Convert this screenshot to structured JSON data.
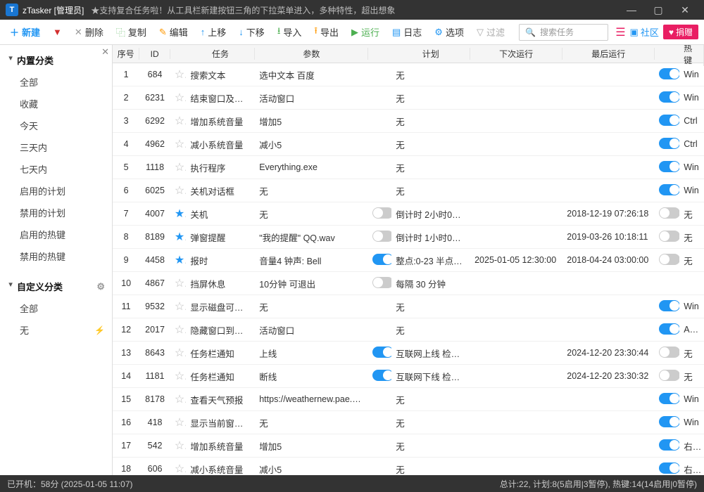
{
  "title": "zTasker [管理员]",
  "subtitle": "★支持复合任务啦！从工具栏新建按钮三角的下拉菜单进入，多种特性，超出想象",
  "toolbar": {
    "new": "新建",
    "delete": "删除",
    "copy": "复制",
    "edit": "编辑",
    "up": "上移",
    "down": "下移",
    "import": "导入",
    "export": "导出",
    "run": "运行",
    "log": "日志",
    "options": "选项",
    "filter": "过滤",
    "search_placeholder": "搜索任务",
    "community": "社区",
    "donate": "捐赠"
  },
  "sidebar": {
    "builtin": {
      "title": "内置分类",
      "items": [
        "全部",
        "收藏",
        "今天",
        "三天内",
        "七天内",
        "启用的计划",
        "禁用的计划",
        "启用的热键",
        "禁用的热键"
      ]
    },
    "custom": {
      "title": "自定义分类",
      "items": [
        "全部",
        "无"
      ]
    }
  },
  "columns": {
    "seq": "序号",
    "id": "ID",
    "name": "任务",
    "param": "参数",
    "plan": "计划",
    "next": "下次运行",
    "last": "最后运行",
    "hot": "热键"
  },
  "rows": [
    {
      "seq": 1,
      "id": 684,
      "fav": false,
      "name": "搜索文本",
      "param": "选中文本 百度",
      "planOn": false,
      "plan": "无",
      "next": "",
      "last": "",
      "hotOn": true,
      "hot": "Win"
    },
    {
      "seq": 2,
      "id": 6231,
      "fav": false,
      "name": "结束窗口及其进…",
      "param": "活动窗口",
      "planOn": false,
      "plan": "无",
      "next": "",
      "last": "",
      "hotOn": true,
      "hot": "Win"
    },
    {
      "seq": 3,
      "id": 6292,
      "fav": false,
      "name": "增加系统音量",
      "param": "增加5",
      "planOn": false,
      "plan": "无",
      "next": "",
      "last": "",
      "hotOn": true,
      "hot": "Ctrl"
    },
    {
      "seq": 4,
      "id": 4962,
      "fav": false,
      "name": "减小系统音量",
      "param": "减小5",
      "planOn": false,
      "plan": "无",
      "next": "",
      "last": "",
      "hotOn": true,
      "hot": "Ctrl"
    },
    {
      "seq": 5,
      "id": 1118,
      "fav": false,
      "name": "执行程序",
      "param": "Everything.exe",
      "planOn": false,
      "plan": "无",
      "next": "",
      "last": "",
      "hotOn": true,
      "hot": "Win"
    },
    {
      "seq": 6,
      "id": 6025,
      "fav": false,
      "name": "关机对话框",
      "param": "无",
      "planOn": false,
      "plan": "无",
      "next": "",
      "last": "",
      "hotOn": true,
      "hot": "Win"
    },
    {
      "seq": 7,
      "id": 4007,
      "fav": true,
      "name": "关机",
      "param": "无",
      "planOn": false,
      "planOff": true,
      "plan": "倒计时 2小时0…",
      "next": "",
      "last": "2018-12-19 07:26:18",
      "hotOn": false,
      "hot": "无"
    },
    {
      "seq": 8,
      "id": 8189,
      "fav": true,
      "name": "弹窗提醒",
      "param": "\"我的提醒\" QQ.wav",
      "planOn": false,
      "planOff": true,
      "plan": "倒计时 1小时0…",
      "next": "",
      "last": "2019-03-26 10:18:11",
      "hotOn": false,
      "hot": "无"
    },
    {
      "seq": 9,
      "id": 4458,
      "fav": true,
      "name": "报时",
      "param": "音量4 钟声: Bell",
      "planOn": true,
      "plan": "整点:0-23 半点…",
      "next": "2025-01-05 12:30:00",
      "last": "2018-04-24 03:00:00",
      "hotOn": false,
      "hot": "无"
    },
    {
      "seq": 10,
      "id": 4867,
      "fav": false,
      "name": "挡屏休息",
      "param": "10分钟 可退出",
      "planOn": false,
      "planOff": true,
      "plan": "每隔 30 分钟",
      "next": "",
      "last": "",
      "hotOn": false,
      "hot": ""
    },
    {
      "seq": 11,
      "id": 9532,
      "fav": false,
      "name": "显示磁盘可用空…",
      "param": "无",
      "planOn": false,
      "plan": "无",
      "next": "",
      "last": "",
      "hotOn": true,
      "hot": "Win"
    },
    {
      "seq": 12,
      "id": 2017,
      "fav": false,
      "name": "隐藏窗口到托盘",
      "param": "活动窗口",
      "planOn": false,
      "plan": "无",
      "next": "",
      "last": "",
      "hotOn": true,
      "hot": "Alt +"
    },
    {
      "seq": 13,
      "id": 8643,
      "fav": false,
      "name": "任务栏通知",
      "param": "上线",
      "planOn": true,
      "plan": "互联网上线 检…",
      "next": "",
      "last": "2024-12-20 23:30:44",
      "hotOn": false,
      "hot": "无"
    },
    {
      "seq": 14,
      "id": 1181,
      "fav": false,
      "name": "任务栏通知",
      "param": "断线",
      "planOn": true,
      "plan": "互联网下线 检…",
      "next": "",
      "last": "2024-12-20 23:30:32",
      "hotOn": false,
      "hot": "无"
    },
    {
      "seq": 15,
      "id": 8178,
      "fav": false,
      "name": "查看天气预报",
      "param": "https://weathernew.pae.ba…",
      "planOn": false,
      "plan": "无",
      "next": "",
      "last": "",
      "hotOn": true,
      "hot": "Win"
    },
    {
      "seq": 16,
      "id": 418,
      "fav": false,
      "name": "显示当前窗口信…",
      "param": "无",
      "planOn": false,
      "plan": "无",
      "next": "",
      "last": "",
      "hotOn": true,
      "hot": "Win"
    },
    {
      "seq": 17,
      "id": 542,
      "fav": false,
      "name": "增加系统音量",
      "param": "增加5",
      "planOn": false,
      "plan": "无",
      "next": "",
      "last": "",
      "hotOn": true,
      "hot": "右键"
    },
    {
      "seq": 18,
      "id": 606,
      "fav": false,
      "name": "减小系统音量",
      "param": "减小5",
      "planOn": false,
      "plan": "无",
      "next": "",
      "last": "",
      "hotOn": true,
      "hot": "右键"
    }
  ],
  "status": {
    "left": "已开机：58分 (2025-01-05 11:07)",
    "right": "总计:22, 计划:8(5启用|3暂停), 热键:14(14启用|0暂停)"
  }
}
